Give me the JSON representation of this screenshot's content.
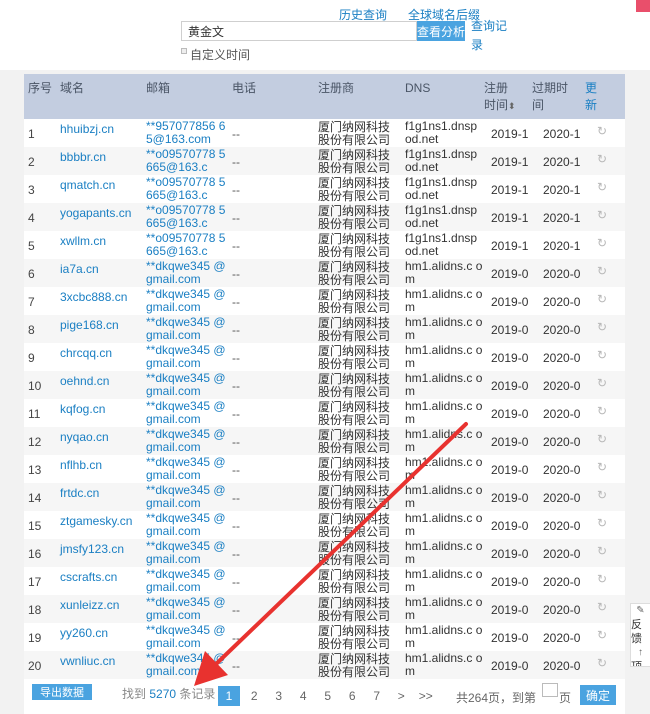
{
  "top": {
    "history_link": "历史查询",
    "global_link": "全球域名后缀",
    "query_record_link": "查询记录",
    "search_value": "黄金文",
    "analyze_button": "查看分析",
    "custom_time": "自定义时间"
  },
  "table": {
    "headers": {
      "index": "序号",
      "domain": "域名",
      "email": "邮箱",
      "phone": "电话",
      "registrar": "注册商",
      "dns": "DNS",
      "reg_time": "注册时间",
      "exp_time": "过期时间",
      "refresh": "更新"
    },
    "rows": [
      {
        "idx": "1",
        "domain": "hhuibzj.cn",
        "email": "**957077856 65@163.com",
        "phone": "--",
        "registrar": "厦门纳网科技股份有限公司",
        "dns": "f1g1ns1.dnsp od.net",
        "reg": "2019-1",
        "exp": "2020-1"
      },
      {
        "idx": "2",
        "domain": "bbbbr.cn",
        "email": "**o09570778 5665@163.c",
        "phone": "--",
        "registrar": "厦门纳网科技股份有限公司",
        "dns": "f1g1ns1.dnsp od.net",
        "reg": "2019-1",
        "exp": "2020-1"
      },
      {
        "idx": "3",
        "domain": "qmatch.cn",
        "email": "**o09570778 5665@163.c",
        "phone": "--",
        "registrar": "厦门纳网科技股份有限公司",
        "dns": "f1g1ns1.dnsp od.net",
        "reg": "2019-1",
        "exp": "2020-1"
      },
      {
        "idx": "4",
        "domain": "yogapants.cn",
        "email": "**o09570778 5665@163.c",
        "phone": "--",
        "registrar": "厦门纳网科技股份有限公司",
        "dns": "f1g1ns1.dnsp od.net",
        "reg": "2019-1",
        "exp": "2020-1"
      },
      {
        "idx": "5",
        "domain": "xwllm.cn",
        "email": "**o09570778 5665@163.c",
        "phone": "--",
        "registrar": "厦门纳网科技股份有限公司",
        "dns": "f1g1ns1.dnsp od.net",
        "reg": "2019-1",
        "exp": "2020-1"
      },
      {
        "idx": "6",
        "domain": "ia7a.cn",
        "email": "**dkqwe345 @gmail.com",
        "phone": "--",
        "registrar": "厦门纳网科技股份有限公司",
        "dns": "hm1.alidns.c om",
        "reg": "2019-0",
        "exp": "2020-0"
      },
      {
        "idx": "7",
        "domain": "3xcbc888.cn",
        "email": "**dkqwe345 @gmail.com",
        "phone": "--",
        "registrar": "厦门纳网科技股份有限公司",
        "dns": "hm1.alidns.c om",
        "reg": "2019-0",
        "exp": "2020-0"
      },
      {
        "idx": "8",
        "domain": "pige168.cn",
        "email": "**dkqwe345 @gmail.com",
        "phone": "--",
        "registrar": "厦门纳网科技股份有限公司",
        "dns": "hm1.alidns.c om",
        "reg": "2019-0",
        "exp": "2020-0"
      },
      {
        "idx": "9",
        "domain": "chrcqq.cn",
        "email": "**dkqwe345 @gmail.com",
        "phone": "--",
        "registrar": "厦门纳网科技股份有限公司",
        "dns": "hm1.alidns.c om",
        "reg": "2019-0",
        "exp": "2020-0"
      },
      {
        "idx": "10",
        "domain": "oehnd.cn",
        "email": "**dkqwe345 @gmail.com",
        "phone": "--",
        "registrar": "厦门纳网科技股份有限公司",
        "dns": "hm1.alidns.c om",
        "reg": "2019-0",
        "exp": "2020-0"
      },
      {
        "idx": "11",
        "domain": "kqfog.cn",
        "email": "**dkqwe345 @gmail.com",
        "phone": "--",
        "registrar": "厦门纳网科技股份有限公司",
        "dns": "hm1.alidns.c om",
        "reg": "2019-0",
        "exp": "2020-0"
      },
      {
        "idx": "12",
        "domain": "nyqao.cn",
        "email": "**dkqwe345 @gmail.com",
        "phone": "--",
        "registrar": "厦门纳网科技股份有限公司",
        "dns": "hm1.alidns.c om",
        "reg": "2019-0",
        "exp": "2020-0"
      },
      {
        "idx": "13",
        "domain": "nflhb.cn",
        "email": "**dkqwe345 @gmail.com",
        "phone": "--",
        "registrar": "厦门纳网科技股份有限公司",
        "dns": "hm1.alidns.c om",
        "reg": "2019-0",
        "exp": "2020-0"
      },
      {
        "idx": "14",
        "domain": "frtdc.cn",
        "email": "**dkqwe345 @gmail.com",
        "phone": "--",
        "registrar": "厦门纳网科技股份有限公司",
        "dns": "hm1.alidns.c om",
        "reg": "2019-0",
        "exp": "2020-0"
      },
      {
        "idx": "15",
        "domain": "ztgamesky.cn",
        "email": "**dkqwe345 @gmail.com",
        "phone": "--",
        "registrar": "厦门纳网科技股份有限公司",
        "dns": "hm1.alidns.c om",
        "reg": "2019-0",
        "exp": "2020-0"
      },
      {
        "idx": "16",
        "domain": "jmsfy123.cn",
        "email": "**dkqwe345 @gmail.com",
        "phone": "--",
        "registrar": "厦门纳网科技股份有限公司",
        "dns": "hm1.alidns.c om",
        "reg": "2019-0",
        "exp": "2020-0"
      },
      {
        "idx": "17",
        "domain": "cscrafts.cn",
        "email": "**dkqwe345 @gmail.com",
        "phone": "--",
        "registrar": "厦门纳网科技股份有限公司",
        "dns": "hm1.alidns.c om",
        "reg": "2019-0",
        "exp": "2020-0"
      },
      {
        "idx": "18",
        "domain": "xunleizz.cn",
        "email": "**dkqwe345 @gmail.com",
        "phone": "--",
        "registrar": "厦门纳网科技股份有限公司",
        "dns": "hm1.alidns.c om",
        "reg": "2019-0",
        "exp": "2020-0"
      },
      {
        "idx": "19",
        "domain": "yy260.cn",
        "email": "**dkqwe345 @gmail.com",
        "phone": "--",
        "registrar": "厦门纳网科技股份有限公司",
        "dns": "hm1.alidns.c om",
        "reg": "2019-0",
        "exp": "2020-0"
      },
      {
        "idx": "20",
        "domain": "vwnliuc.cn",
        "email": "**dkqwe345 @gmail.com",
        "phone": "--",
        "registrar": "厦门纳网科技股份有限公司",
        "dns": "hm1.alidns.c om",
        "reg": "2019-0",
        "exp": "2020-0"
      }
    ]
  },
  "footer": {
    "export_button": "导出数据",
    "found_prefix": "找到",
    "found_count": "5270",
    "found_suffix": "条记录",
    "pages": [
      "1",
      "2",
      "3",
      "4",
      "5",
      "6",
      "7",
      ">",
      ">>"
    ],
    "active_page": "1",
    "total_text": "共264页，到第",
    "page_unit": "页",
    "confirm_button": "确定"
  },
  "side_widget": {
    "feedback": "反馈",
    "top": "顶部"
  },
  "colors": {
    "accent": "#4aa3e0",
    "link": "#1a7fc3",
    "header_bg": "#c3cde0",
    "arrow": "#e8322f"
  }
}
